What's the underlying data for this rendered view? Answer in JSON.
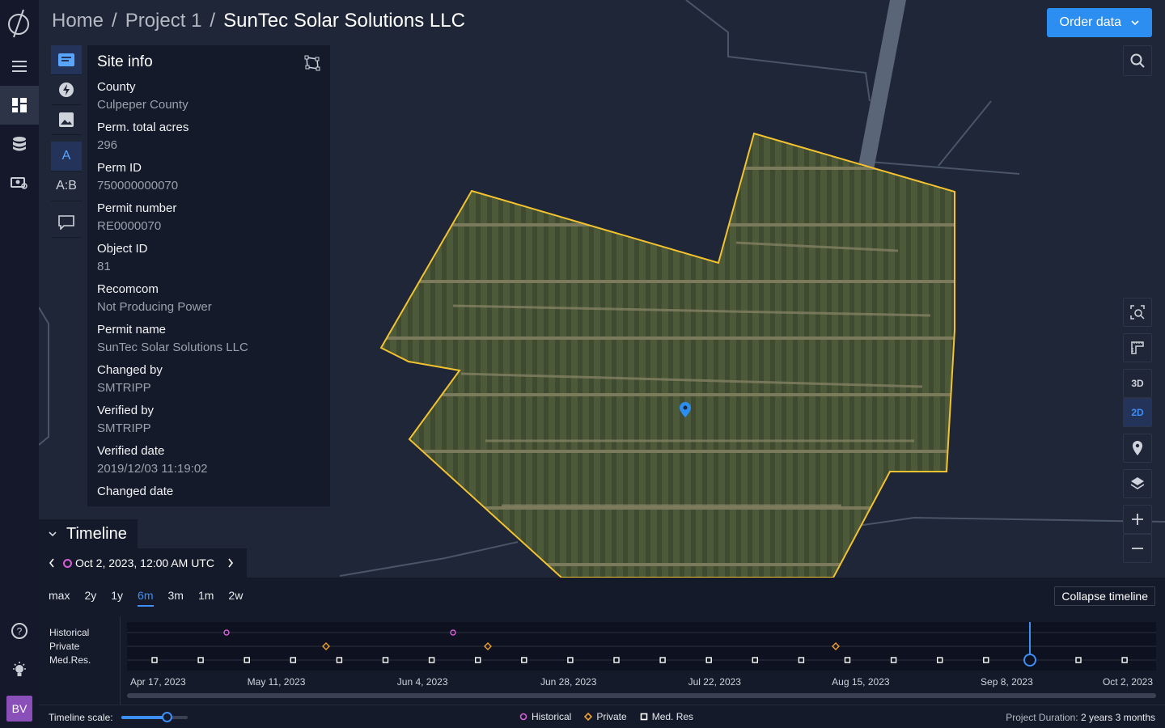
{
  "breadcrumb": {
    "home": "Home",
    "sep1": "/",
    "project": "Project 1",
    "sep2": "/",
    "current": "SunTec Solar Solutions LLC"
  },
  "order_button": {
    "label": "Order data"
  },
  "site_info": {
    "title": "Site info",
    "fields": [
      {
        "label": "County",
        "value": "Culpeper County"
      },
      {
        "label": "Perm. total acres",
        "value": "296"
      },
      {
        "label": "Perm ID",
        "value": "750000000070"
      },
      {
        "label": "Permit number",
        "value": "RE0000070"
      },
      {
        "label": "Object ID",
        "value": "81"
      },
      {
        "label": "Recomcom",
        "value": "Not Producing Power"
      },
      {
        "label": "Permit name",
        "value": "SunTec Solar Solutions LLC"
      },
      {
        "label": "Changed by",
        "value": "SMTRIPP"
      },
      {
        "label": "Verified by",
        "value": "SMTRIPP"
      },
      {
        "label": "Verified date",
        "value": "2019/12/03 11:19:02"
      },
      {
        "label": "Changed date",
        "value": ""
      }
    ]
  },
  "tools": {
    "compare_a": "A",
    "compare_ab": "A:B"
  },
  "map_controls": {
    "view_3d": "3D",
    "view_2d": "2D"
  },
  "timeline": {
    "title": "Timeline",
    "current_date": "Oct 2, 2023, 12:00 AM UTC",
    "ranges": [
      "max",
      "2y",
      "1y",
      "6m",
      "3m",
      "1m",
      "2w"
    ],
    "active_range": "6m",
    "collapse_label": "Collapse timeline",
    "tracks": [
      "Historical",
      "Private",
      "Med.Res."
    ],
    "axis_dates": [
      "Apr 17, 2023",
      "May 11, 2023",
      "Jun 4, 2023",
      "Jun 28, 2023",
      "Jul 22, 2023",
      "Aug 15, 2023",
      "Sep 8, 2023",
      "Oct 2, 2023"
    ],
    "scale_label": "Timeline scale:",
    "scale_value": 0.68,
    "legend": {
      "historical": "Historical",
      "private": "Private",
      "medres": "Med. Res"
    },
    "duration_label": "Project Duration:",
    "duration_value": "2 years 3 months"
  },
  "user": {
    "initials": "BV"
  },
  "colors": {
    "accent": "#2c8ef0",
    "historical": "#d65fd6",
    "private": "#f0a030",
    "boundary": "#f2c230"
  }
}
